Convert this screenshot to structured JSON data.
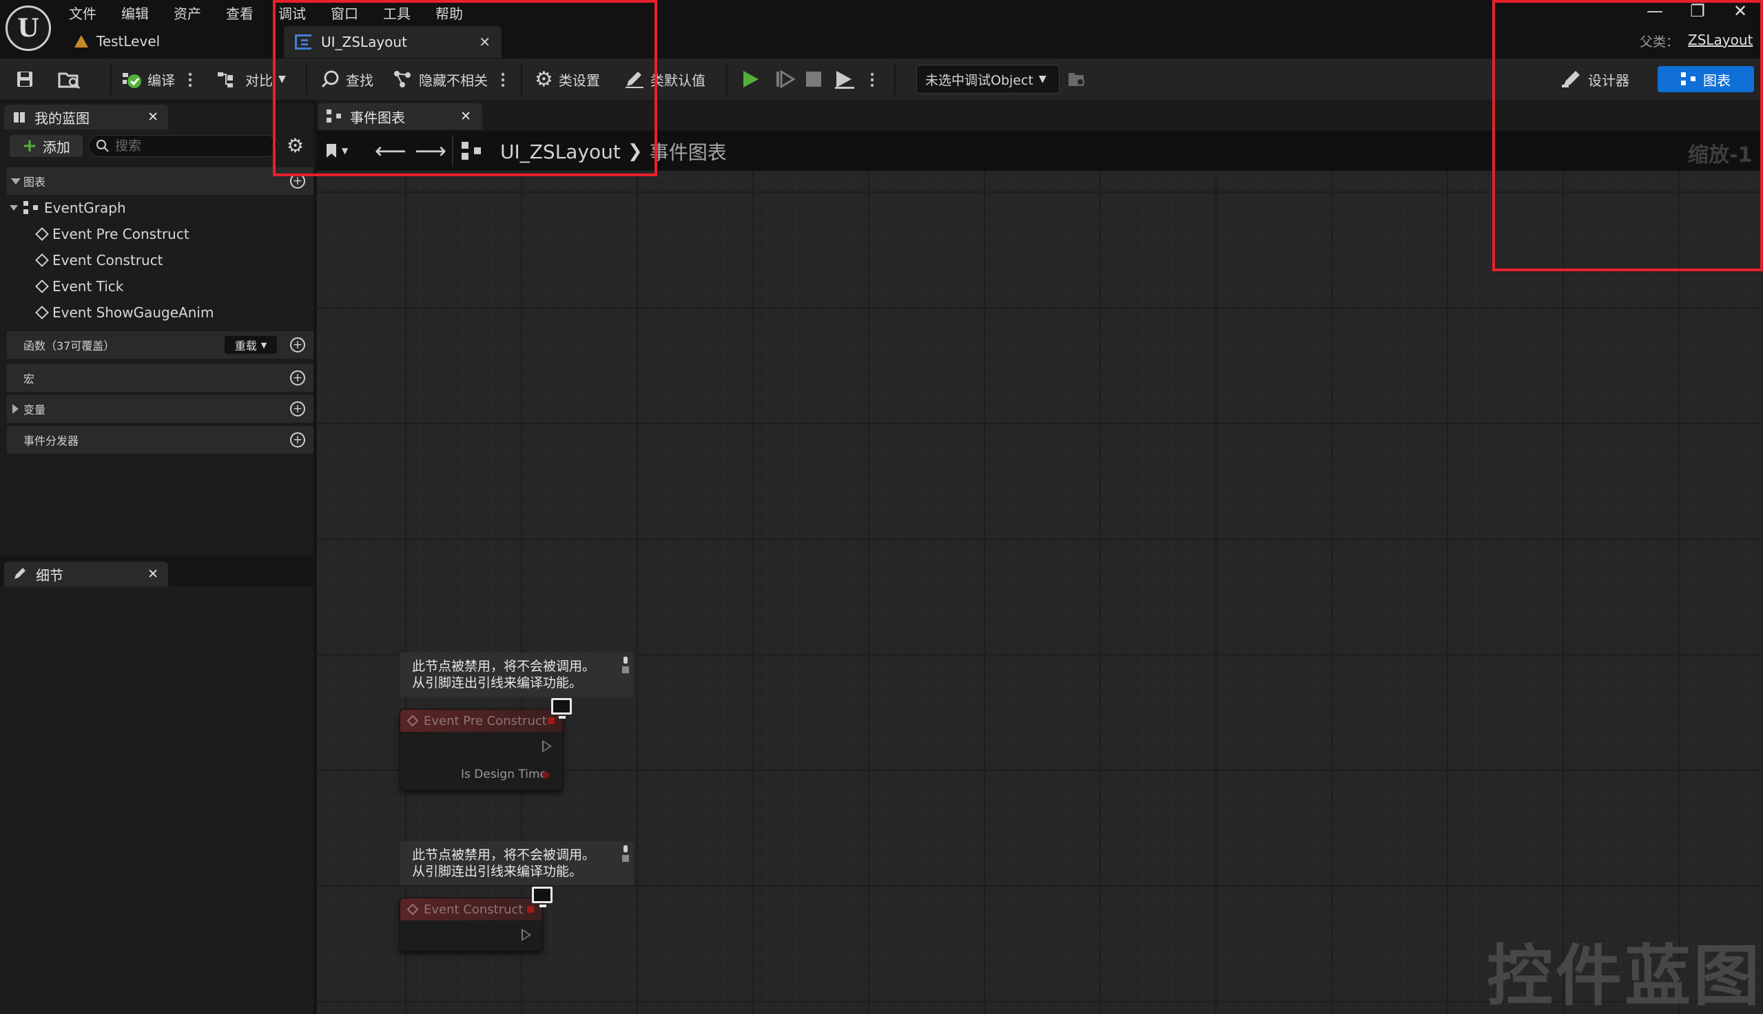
{
  "menu": [
    "文件",
    "编辑",
    "资产",
    "查看",
    "调试",
    "窗口",
    "工具",
    "帮助"
  ],
  "level_tab": "TestLevel",
  "asset_tab": "UI_ZSLayout",
  "window_controls": {
    "minimize": "—",
    "restore": "❐",
    "close": "✕"
  },
  "parent": {
    "label": "父类：",
    "value": "ZSLayout"
  },
  "toolbar": {
    "compile": "编译",
    "diff": "对比",
    "find": "查找",
    "hide_unrelated": "隐藏不相关",
    "class_settings": "类设置",
    "class_defaults": "类默认值",
    "debug_object": "未选中调试Object",
    "designer": "设计器",
    "graph": "图表"
  },
  "my_blueprint": {
    "tab": "我的蓝图",
    "add": "添加",
    "search_placeholder": "搜索",
    "sections": {
      "graphs": "图表",
      "functions": "函数（37可覆盖）",
      "override": "重载",
      "macros": "宏",
      "variables": "变量",
      "dispatchers": "事件分发器"
    },
    "event_graph": "EventGraph",
    "events": [
      "Event Pre Construct",
      "Event Construct",
      "Event Tick",
      "Event ShowGaugeAnim"
    ]
  },
  "details": {
    "tab": "细节"
  },
  "graph": {
    "tab": "事件图表",
    "breadcrumb_root": "UI_ZSLayout",
    "breadcrumb_sub": "事件图表",
    "zoom": "缩放-1",
    "watermark": "控件蓝图",
    "nodes": [
      {
        "comment_line1": "此节点被禁用，将不会被调用。",
        "comment_line2": "从引脚连出引线来编译功能。",
        "title": "Event Pre Construct",
        "pin_label": "Is Design Time"
      },
      {
        "comment_line1": "此节点被禁用，将不会被调用。",
        "comment_line2": "从引脚连出引线来编译功能。",
        "title": "Event Construct"
      }
    ]
  },
  "colors": {
    "accent": "#0f6fd6",
    "highlight": "#e8202a",
    "play": "#53b13a"
  }
}
